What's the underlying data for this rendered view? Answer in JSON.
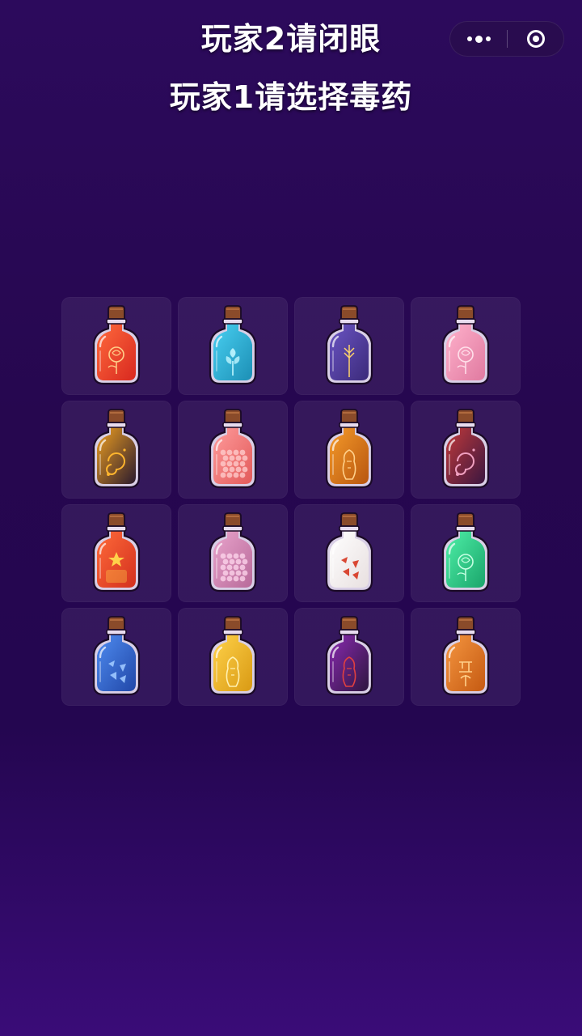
{
  "header": {
    "line1": "玩家2请闭眼",
    "line2": "玩家1请选择毒药"
  },
  "capsule": {
    "more_icon": "more-dots-icon",
    "close_icon": "close-target-icon"
  },
  "potions": [
    {
      "liquid": "#d8281f",
      "light": "#ff6b3d",
      "deco": "rose",
      "accent": "#ffcf8a"
    },
    {
      "liquid": "#1c8fb5",
      "light": "#49d0f2",
      "deco": "flower",
      "accent": "#bff6ff"
    },
    {
      "liquid": "#3b2a7a",
      "light": "#6b55c4",
      "deco": "wheat",
      "accent": "#ffd36b"
    },
    {
      "liquid": "#e07aa0",
      "light": "#ffb2cc",
      "deco": "rose",
      "accent": "#ffe0ea"
    },
    {
      "liquid": "#2a1a2e",
      "light": "#f0a020",
      "deco": "swirl",
      "accent": "#ffb52e"
    },
    {
      "liquid": "#e25a5a",
      "light": "#ff9c9c",
      "deco": "beads",
      "accent": "#ffd0d0"
    },
    {
      "liquid": "#b8560e",
      "light": "#f59b2b",
      "deco": "figure",
      "accent": "#ffd08a"
    },
    {
      "liquid": "#3a1640",
      "light": "#c23a3a",
      "deco": "swirl",
      "accent": "#f0a0c0"
    },
    {
      "liquid": "#d3301e",
      "light": "#ff6b3a",
      "deco": "star",
      "accent": "#ffd24a"
    },
    {
      "liquid": "#b86a9a",
      "light": "#e9a4cc",
      "deco": "beads",
      "accent": "#ffd8ee"
    },
    {
      "liquid": "#e8e0e0",
      "light": "#ffffff",
      "deco": "flakes",
      "accent": "#d6351f"
    },
    {
      "liquid": "#1aa56b",
      "light": "#4ff0a8",
      "deco": "rose",
      "accent": "#c6ffe3"
    },
    {
      "liquid": "#2147a8",
      "light": "#4f8cf0",
      "deco": "flakes",
      "accent": "#9fc9ff"
    },
    {
      "liquid": "#d99a14",
      "light": "#ffd24a",
      "deco": "figure",
      "accent": "#fff0b0"
    },
    {
      "liquid": "#2e1640",
      "light": "#8a2ab0",
      "deco": "figure",
      "accent": "#e04040"
    },
    {
      "liquid": "#c55a12",
      "light": "#f59640",
      "deco": "script",
      "accent": "#ffd08a"
    }
  ]
}
